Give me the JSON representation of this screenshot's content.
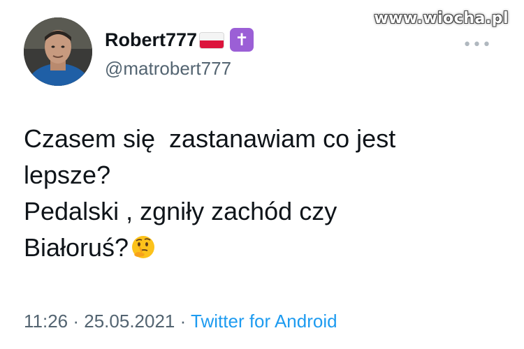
{
  "watermark": "www.wiocha.pl",
  "user": {
    "display_name": "Robert777",
    "handle": "@matrobert777",
    "badges": [
      "poland-flag-icon",
      "latin-cross-icon"
    ]
  },
  "tweet": {
    "lines": [
      "Czasem się  zastanawiam co jest",
      "lepsze?",
      "Pedalski , zgniły zachód czy",
      "Białoruś?"
    ],
    "emoji": "thinking-face-icon"
  },
  "meta": {
    "time": "11:26",
    "separator": " · ",
    "date": "25.05.2021",
    "source": "Twitter for Android"
  },
  "colors": {
    "text": "#0f1419",
    "secondary": "#536471",
    "link": "#1d9bf0",
    "cross_badge": "#9b5fd6",
    "flag_red": "#dc143c"
  }
}
